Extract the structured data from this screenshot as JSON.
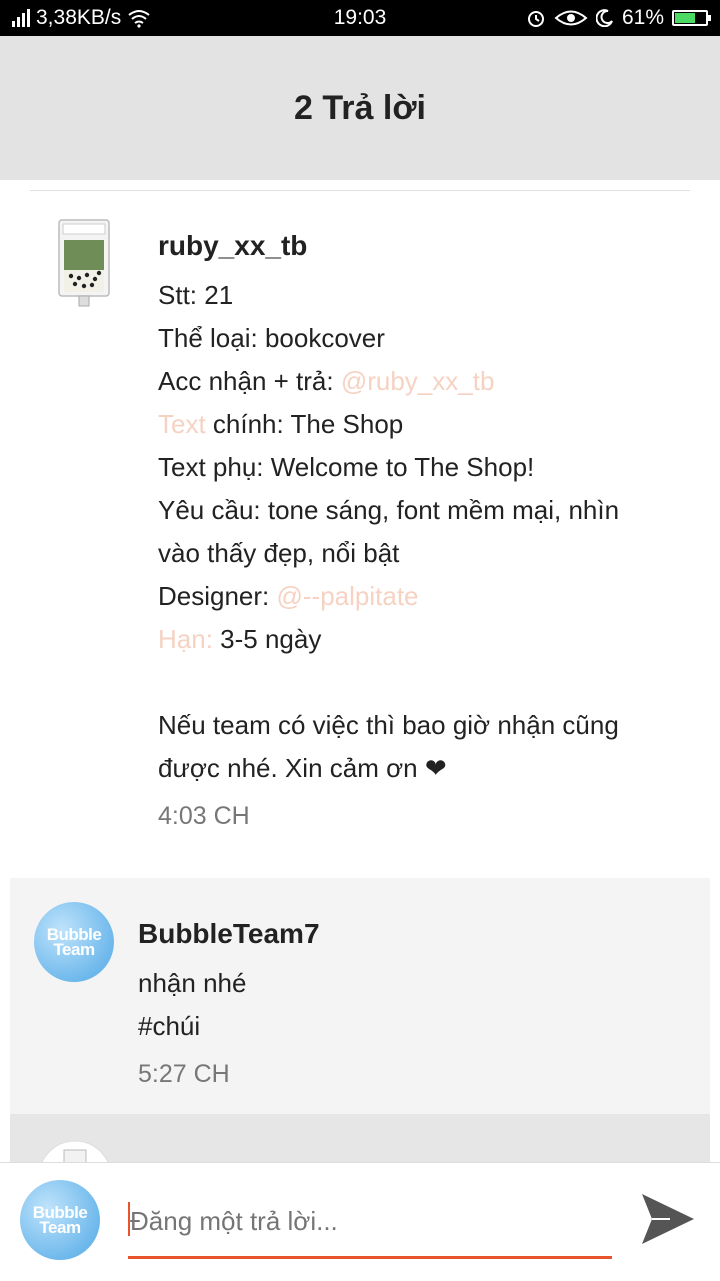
{
  "status_bar": {
    "net_speed": "3,38KB/s",
    "time": "19:03",
    "battery_percent": "61%",
    "battery_level": 0.61
  },
  "header": {
    "title": "2 Trả lời"
  },
  "post": {
    "username": "ruby_xx_tb",
    "lines": [
      {
        "text": "Stt: 21"
      },
      {
        "text": "Thể loại: bookcover"
      },
      {
        "prefix": "Acc nhận + trả: ",
        "mention": "@ruby_xx_tb"
      },
      {
        "mention": "Text",
        "suffix": " chính: The Shop"
      },
      {
        "text": "Text phụ: Welcome to The Shop!"
      },
      {
        "text": "Yêu cầu: tone sáng, font mềm mại, nhìn"
      },
      {
        "text": "vào thấy đẹp, nổi bật"
      },
      {
        "prefix": "Designer: ",
        "mention": "@--palpitate"
      },
      {
        "mention": "Hạn:",
        "suffix": " 3-5 ngày"
      },
      {
        "text": "Nếu team có việc thì bao giờ nhận cũng"
      },
      {
        "text": "được nhé. Xin cảm ơn ❤"
      }
    ],
    "time": "4:03 CH"
  },
  "reply": {
    "username": "BubbleTeam7",
    "avatar_text": "Bubble Team",
    "lines": [
      "nhận nhé",
      "#chúi"
    ],
    "time": "5:27 CH"
  },
  "composer": {
    "placeholder": "Đăng một trả lời...",
    "avatar_text": "Bubble Team"
  }
}
